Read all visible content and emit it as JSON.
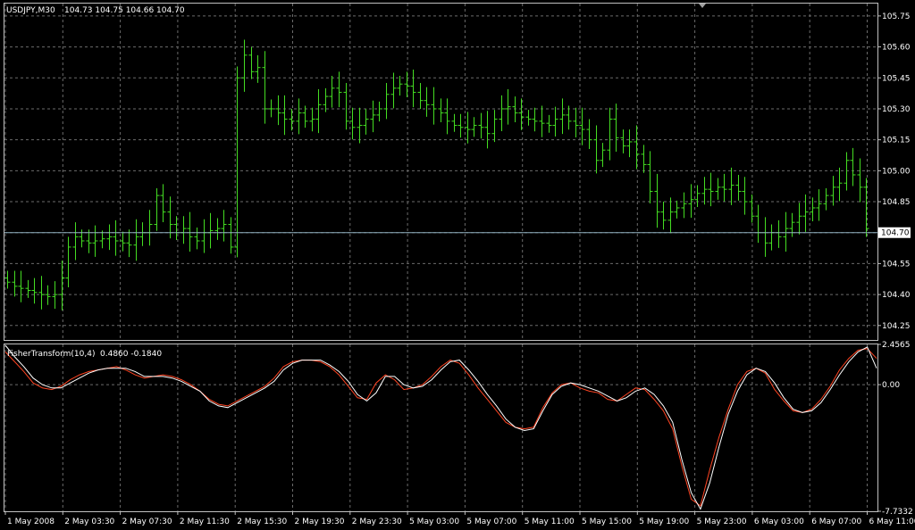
{
  "colors": {
    "background": "#000000",
    "grid": "#6b6b6b",
    "frame": "#c0c0c0",
    "bars": "#44dd22",
    "fisher_main": "#ffffff",
    "fisher_signal": "#ff4422",
    "text": "#ffffff",
    "price_line": "#8fb0c0"
  },
  "header": {
    "symbol": "USDJPY,M30",
    "ohlc": "104.73 104.75 104.66 104.70"
  },
  "indicator_header": {
    "name": "FisherTransform(10,4)",
    "values": "0.4860 -0.1840"
  },
  "current_price_label": "104.70",
  "chart_data": [
    {
      "type": "ohlc_bar",
      "title": "USDJPY,M30",
      "ylim": [
        104.18,
        105.81
      ],
      "y_ticks": [
        "105.75",
        "105.60",
        "105.45",
        "105.30",
        "105.15",
        "105.00",
        "104.85",
        "104.70",
        "104.55",
        "104.40",
        "104.25"
      ],
      "current_price": 104.7,
      "x_tick_labels": [
        "1 May 2008",
        "2 May 03:30",
        "2 May 07:30",
        "2 May 11:30",
        "2 May 15:30",
        "2 May 19:30",
        "2 May 23:30",
        "5 May 03:00",
        "5 May 07:00",
        "5 May 11:00",
        "5 May 15:00",
        "5 May 19:00",
        "5 May 23:00",
        "6 May 03:00",
        "6 May 07:00",
        "6 May 11:00"
      ],
      "closes": [
        104.46,
        104.44,
        104.43,
        104.42,
        104.41,
        104.4,
        104.39,
        104.4,
        104.48,
        104.63,
        104.68,
        104.66,
        104.65,
        104.66,
        104.67,
        104.68,
        104.66,
        104.65,
        104.64,
        104.68,
        104.7,
        104.74,
        104.88,
        104.8,
        104.74,
        104.7,
        104.72,
        104.68,
        104.66,
        104.7,
        104.71,
        104.72,
        104.74,
        104.63,
        105.45,
        105.56,
        105.48,
        105.5,
        105.3,
        105.3,
        105.28,
        105.25,
        105.24,
        105.28,
        105.24,
        105.25,
        105.32,
        105.36,
        105.4,
        105.38,
        105.24,
        105.21,
        105.22,
        105.25,
        105.27,
        105.3,
        105.37,
        105.4,
        105.42,
        105.41,
        105.38,
        105.34,
        105.32,
        105.3,
        105.28,
        105.24,
        105.22,
        105.21,
        105.2,
        105.22,
        105.21,
        105.18,
        105.25,
        105.3,
        105.31,
        105.28,
        105.26,
        105.25,
        105.24,
        105.23,
        105.22,
        105.25,
        105.27,
        105.24,
        105.22,
        105.2,
        105.15,
        105.05,
        105.1,
        105.25,
        105.16,
        105.12,
        105.14,
        105.08,
        105.03,
        104.9,
        104.8,
        104.76,
        104.8,
        104.82,
        104.84,
        104.86,
        104.89,
        104.91,
        104.9,
        104.92,
        104.91,
        104.93,
        104.9,
        104.85,
        104.78,
        104.7,
        104.65,
        104.7,
        104.68,
        104.72,
        104.75,
        104.78,
        104.8,
        104.82,
        104.84,
        104.88,
        104.92,
        104.94,
        105.05,
        104.98,
        104.92,
        104.72
      ],
      "note_closes": "approximate per-bar closing prices read from the chart"
    },
    {
      "type": "line",
      "title": "FisherTransform(10,4)",
      "ylim": [
        -7.7332,
        2.4565
      ],
      "y_ticks": [
        "2.4565",
        "0.00",
        "-7.7332"
      ],
      "series": [
        {
          "values": [
            2.0,
            1.4,
            0.8,
            0.1,
            -0.2,
            -0.3,
            -0.1,
            0.3,
            0.6,
            0.8,
            0.9,
            1.0,
            1.1,
            0.9,
            0.6,
            0.4,
            0.5,
            0.6,
            0.5,
            0.3,
            0.0,
            -0.4,
            -0.9,
            -1.2,
            -1.3,
            -1.0,
            -0.7,
            -0.4,
            -0.1,
            0.4,
            1.1,
            1.4,
            1.5,
            1.5,
            1.4,
            1.1,
            0.6,
            -0.1,
            -0.8,
            -0.9,
            0.1,
            0.6,
            0.3,
            -0.3,
            -0.2,
            0.0,
            0.5,
            1.1,
            1.5,
            1.3,
            0.6,
            -0.2,
            -0.9,
            -1.6,
            -2.3,
            -2.6,
            -2.7,
            -2.6,
            -1.4,
            -0.5,
            0.0,
            0.1,
            -0.2,
            -0.4,
            -0.5,
            -0.9,
            -1.0,
            -0.6,
            -0.2,
            -0.3,
            -0.9,
            -1.6,
            -2.7,
            -5.0,
            -7.0,
            -7.4,
            -5.2,
            -3.2,
            -1.5,
            0.0,
            0.8,
            1.0,
            0.7,
            -0.3,
            -1.0,
            -1.6,
            -1.7,
            -1.5,
            -0.9,
            -0.1,
            0.9,
            1.6,
            2.1,
            2.2,
            1.6
          ]
        },
        {
          "values": [
            2.4,
            1.7,
            1.1,
            0.4,
            0.0,
            -0.2,
            -0.2,
            0.1,
            0.4,
            0.7,
            0.9,
            1.0,
            1.0,
            1.0,
            0.8,
            0.5,
            0.5,
            0.5,
            0.4,
            0.2,
            -0.1,
            -0.4,
            -1.0,
            -1.3,
            -1.4,
            -1.1,
            -0.8,
            -0.5,
            -0.2,
            0.2,
            0.9,
            1.3,
            1.5,
            1.5,
            1.5,
            1.2,
            0.8,
            0.2,
            -0.6,
            -1.0,
            -0.5,
            0.5,
            0.5,
            0.0,
            -0.2,
            -0.1,
            0.3,
            0.9,
            1.4,
            1.5,
            0.9,
            0.2,
            -0.6,
            -1.3,
            -2.1,
            -2.6,
            -2.8,
            -2.7,
            -1.6,
            -0.6,
            -0.1,
            0.1,
            0.0,
            -0.2,
            -0.4,
            -0.7,
            -1.0,
            -0.8,
            -0.4,
            -0.2,
            -0.6,
            -1.3,
            -2.3,
            -4.6,
            -6.6,
            -7.6,
            -6.0,
            -3.8,
            -1.8,
            -0.4,
            0.6,
            1.0,
            0.8,
            0.1,
            -0.8,
            -1.5,
            -1.7,
            -1.6,
            -1.1,
            -0.3,
            0.6,
            1.4,
            2.0,
            2.3,
            1.0
          ]
        }
      ]
    }
  ]
}
